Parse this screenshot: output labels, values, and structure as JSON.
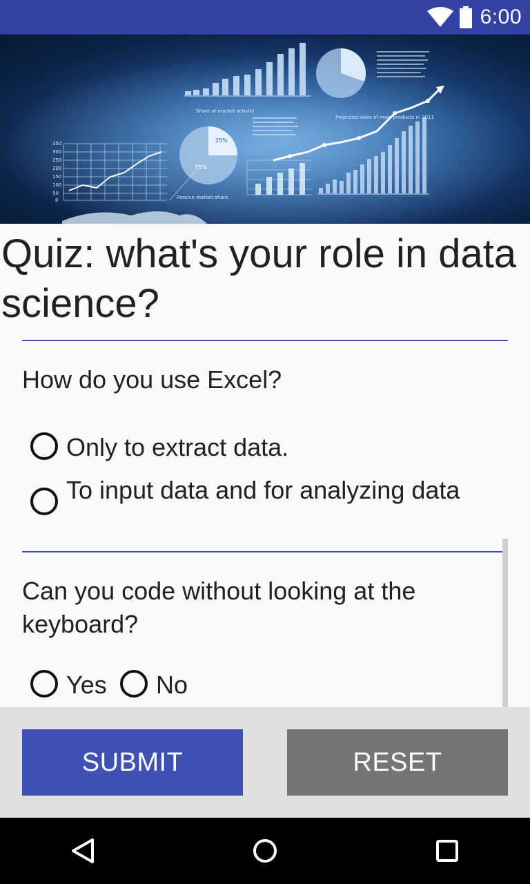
{
  "status_bar": {
    "time": "6:00",
    "wifi_icon": "wifi-icon",
    "battery_icon": "battery-icon"
  },
  "hero": {
    "description_icon": "data-analytics-image",
    "chart_labels": [
      "Share of market activity",
      "Passive market share",
      "Projected sales of main products in 2013",
      "25%",
      "75%"
    ],
    "y_ticks": [
      "350",
      "300",
      "250",
      "200",
      "150",
      "100",
      "50",
      "0"
    ]
  },
  "title": "Quiz: what's your role in data science?",
  "questions": [
    {
      "text": "How do you use Excel?",
      "options": [
        "Only to extract data.",
        "To input data and for analyzing data"
      ]
    },
    {
      "text": "Can you code without looking at the keyboard?",
      "options": [
        "Yes",
        "No"
      ]
    }
  ],
  "buttons": {
    "submit": "SUBMIT",
    "reset": "RESET"
  },
  "colors": {
    "primary": "#3f51b5",
    "status_bar": "#3443a3",
    "reset": "#757575"
  },
  "nav": {
    "back_icon": "back-icon",
    "home_icon": "home-icon",
    "recents_icon": "recents-icon"
  }
}
